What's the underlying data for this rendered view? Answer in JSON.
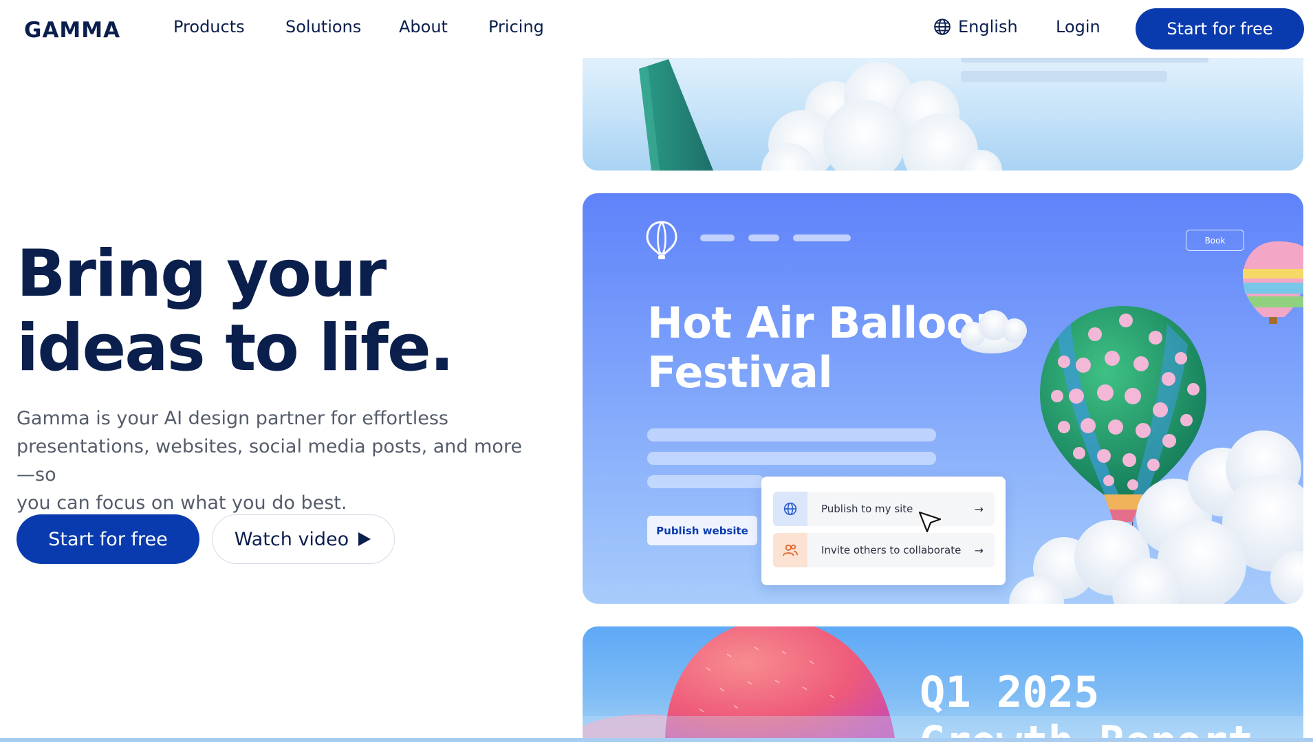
{
  "nav": {
    "logo": "GAMMA",
    "links": [
      "Products",
      "Solutions",
      "About",
      "Pricing"
    ],
    "language": "English",
    "login": "Login",
    "cta": "Start for free"
  },
  "hero": {
    "title_lines": [
      "Bring your",
      "ideas to life."
    ],
    "subtitle_lines": [
      "Gamma is your AI design partner for effortless",
      "presentations, websites, social media posts, and more—so",
      "you can focus on what you do best."
    ],
    "primary_cta": "Start for free",
    "secondary_cta": "Watch video"
  },
  "showcase": {
    "main_card": {
      "title_lines": [
        "Hot Air Balloon",
        "Festival"
      ],
      "book_button": "Book",
      "publish_button": "Publish website",
      "popup": {
        "rows": [
          {
            "label": "Publish to my site",
            "icon": "globe-icon"
          },
          {
            "label": "Invite others to collaborate",
            "icon": "users-icon"
          }
        ]
      }
    },
    "bottom_card": {
      "title_lines": [
        "Q1 2025",
        "Growth Report"
      ]
    }
  },
  "colors": {
    "brand_navy": "#0b1f4d",
    "brand_blue": "#0a3bae",
    "card_blue": "#6689f9"
  }
}
